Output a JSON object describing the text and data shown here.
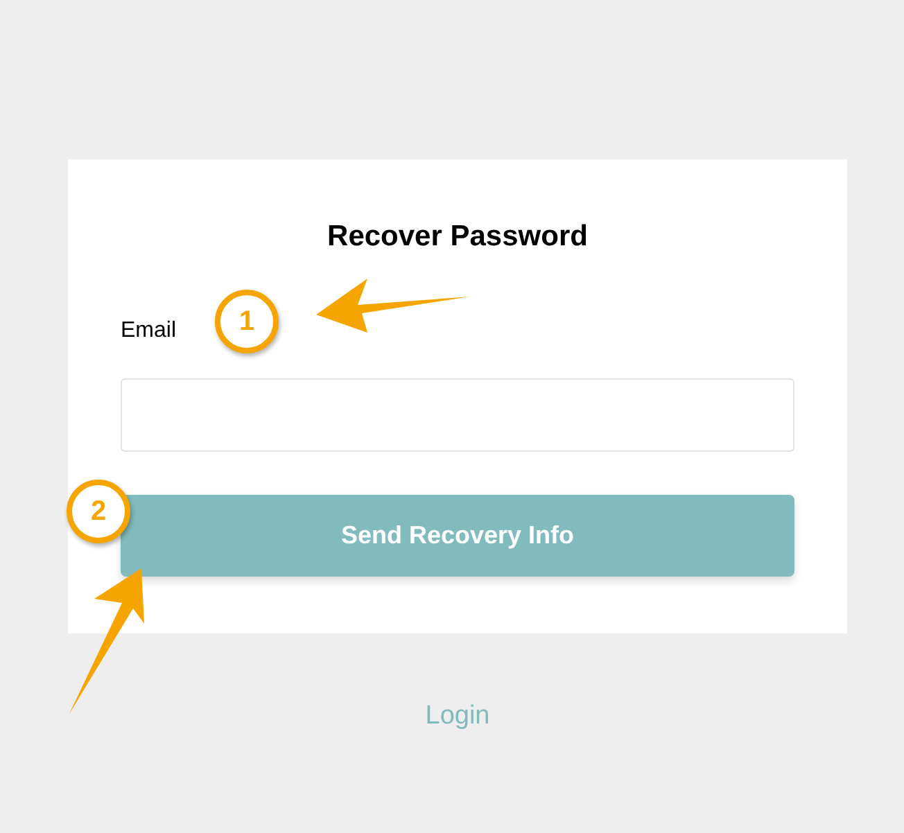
{
  "card": {
    "title": "Recover Password",
    "email": {
      "label": "Email"
    },
    "submit": "Send Recovery Info"
  },
  "login_link": "Login",
  "callouts": [
    {
      "number": "1"
    },
    {
      "number": "2"
    }
  ]
}
